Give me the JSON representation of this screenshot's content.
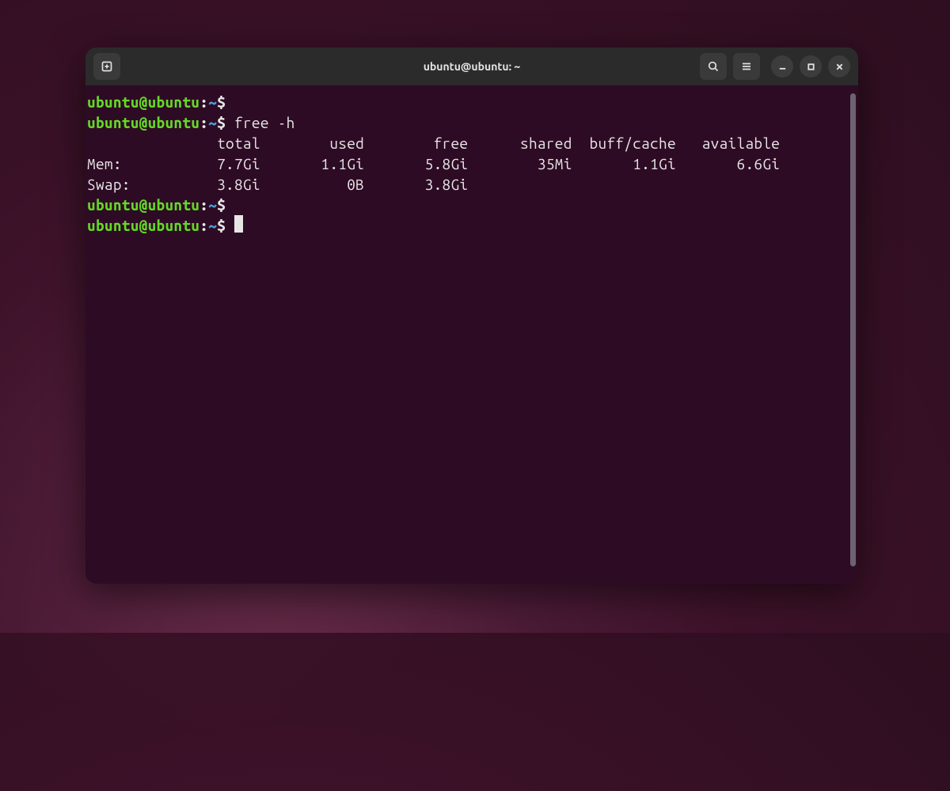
{
  "window": {
    "title": "ubuntu@ubuntu: ~"
  },
  "prompt": {
    "user_host": "ubuntu@ubuntu",
    "sep1": ":",
    "path": "~",
    "sigil": "$"
  },
  "lines": {
    "cmd1": "",
    "cmd2": "free -h",
    "header": "               total        used        free      shared  buff/cache   available",
    "mem": "Mem:           7.7Gi       1.1Gi       5.8Gi        35Mi       1.1Gi       6.6Gi",
    "swap": "Swap:          3.8Gi          0B       3.8Gi",
    "cmd3": "",
    "cmd4": ""
  },
  "free_output": {
    "columns": [
      "total",
      "used",
      "free",
      "shared",
      "buff/cache",
      "available"
    ],
    "mem": {
      "total": "7.7Gi",
      "used": "1.1Gi",
      "free": "5.8Gi",
      "shared": "35Mi",
      "buff_cache": "1.1Gi",
      "available": "6.6Gi"
    },
    "swap": {
      "total": "3.8Gi",
      "used": "0B",
      "free": "3.8Gi"
    }
  },
  "scrollbar_thumb_pct": 98
}
